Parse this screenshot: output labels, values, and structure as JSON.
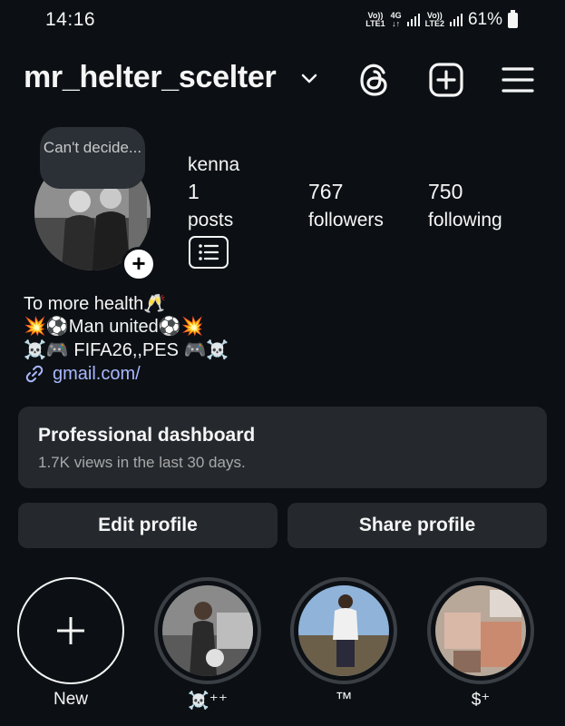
{
  "status": {
    "time": "14:16",
    "net1_top": "Vo))",
    "net1_bottom": "LTE1",
    "net_type": "4G",
    "net2_top": "Vo))",
    "net2_bottom": "LTE2",
    "battery": "61%"
  },
  "header": {
    "username": "mr_helter_scelter"
  },
  "profile": {
    "note": "Can't decide...",
    "display_name": "kenna"
  },
  "stats": [
    {
      "value": "1",
      "label": "posts"
    },
    {
      "value": "767",
      "label": "followers"
    },
    {
      "value": "750",
      "label": "following"
    }
  ],
  "bio": {
    "lines": [
      "To more health🥂",
      "💥⚽Man united⚽💥",
      "☠️🎮 FIFA26,,PES 🎮☠️"
    ],
    "link": "gmail.com/"
  },
  "dashboard": {
    "title": "Professional dashboard",
    "subtitle": "1.7K views in the last 30 days."
  },
  "buttons": {
    "edit": "Edit profile",
    "share": "Share profile"
  },
  "highlights": [
    {
      "label": "New"
    },
    {
      "label": "☠️⁺⁺"
    },
    {
      "label": "™"
    },
    {
      "label": "$⁺"
    }
  ]
}
